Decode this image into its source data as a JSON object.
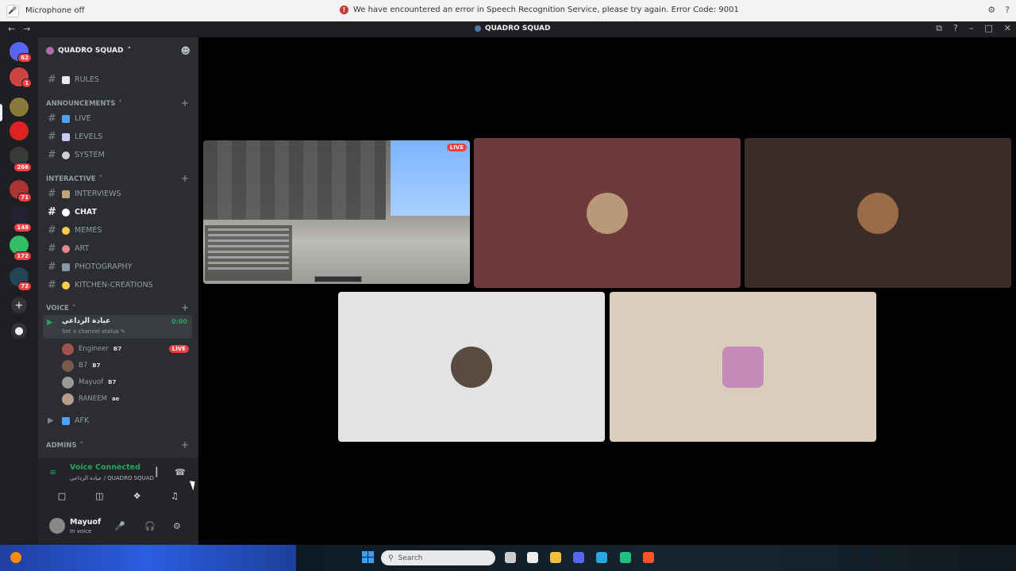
{
  "system": {
    "mic_status": "Microphone off",
    "error_text": "We have encountered an error in Speech Recognition Service, please try again. Error Code: 9001",
    "icons": [
      "settings-icon",
      "help-icon"
    ]
  },
  "window": {
    "title": "QUADRO SQUAD",
    "nav": [
      "←",
      "→"
    ],
    "controls": [
      "⧉",
      "?",
      "–",
      "□",
      "✕"
    ]
  },
  "rail": {
    "badges": [
      "62",
      "1",
      "266",
      "71",
      "148",
      "172",
      "72"
    ]
  },
  "server": {
    "name": "QUADRO SQUAD",
    "channels_top": [
      {
        "name": "RULES",
        "color": "#e8e8e8"
      }
    ],
    "announcements": {
      "label": "ANNOUNCEMENTS",
      "channels": [
        {
          "name": "LIVE",
          "color": "#4aa3ff"
        },
        {
          "name": "LEVELS",
          "color": "#c9c9ff"
        },
        {
          "name": "SYSTEM",
          "color": "#cfcfcf"
        }
      ]
    },
    "interactive": {
      "label": "INTERACTIVE",
      "channels": [
        {
          "name": "INTERVIEWS",
          "color": "#c1a37a"
        },
        {
          "name": "CHAT",
          "color": "#ffffff"
        },
        {
          "name": "MEMES",
          "color": "#ffcc4d"
        },
        {
          "name": "ART",
          "color": "#e8888c"
        },
        {
          "name": "PHOTOGRAPHY",
          "color": "#8899aa"
        },
        {
          "name": "KITCHEN-CREATIONS",
          "color": "#ffcc4d"
        }
      ]
    },
    "voice": {
      "label": "VOICE",
      "channel_name": "عيادة الرداعي",
      "timer": "0:00",
      "status": "Set a channel status",
      "members": [
        {
          "name": "Engineer",
          "tag": "B7",
          "live": "LIVE",
          "color": "#a0524e"
        },
        {
          "name": "B7",
          "tag": "B7",
          "live": "",
          "color": "#7a5a4a"
        },
        {
          "name": "Mayuof",
          "tag": "B7",
          "live": "",
          "color": "#999"
        },
        {
          "name": "RANEEM",
          "tag": "ae",
          "live": "",
          "color": "#b89c8a"
        }
      ],
      "afk": "AFK"
    },
    "admins": {
      "label": "ADMINS"
    }
  },
  "voice_panel": {
    "title": "Voice Connected",
    "subtitle": "عيادة الرداعي / QUADRO SQUAD"
  },
  "user": {
    "name": "Mayuof",
    "status": "In voice"
  },
  "stage": {
    "stream_badge": "LIVE",
    "tiles": [
      {
        "bg": "#6f3a3a",
        "avatar": "#b89a7a"
      },
      {
        "bg": "#3a2c26",
        "avatar": "#9b6a48"
      },
      {
        "bg": "#e3e3e3",
        "avatar": "#5a4a42"
      },
      {
        "bg": "#d9cdbb",
        "avatar": "#c48ab8"
      }
    ]
  },
  "taskbar": {
    "search_placeholder": "Search"
  }
}
